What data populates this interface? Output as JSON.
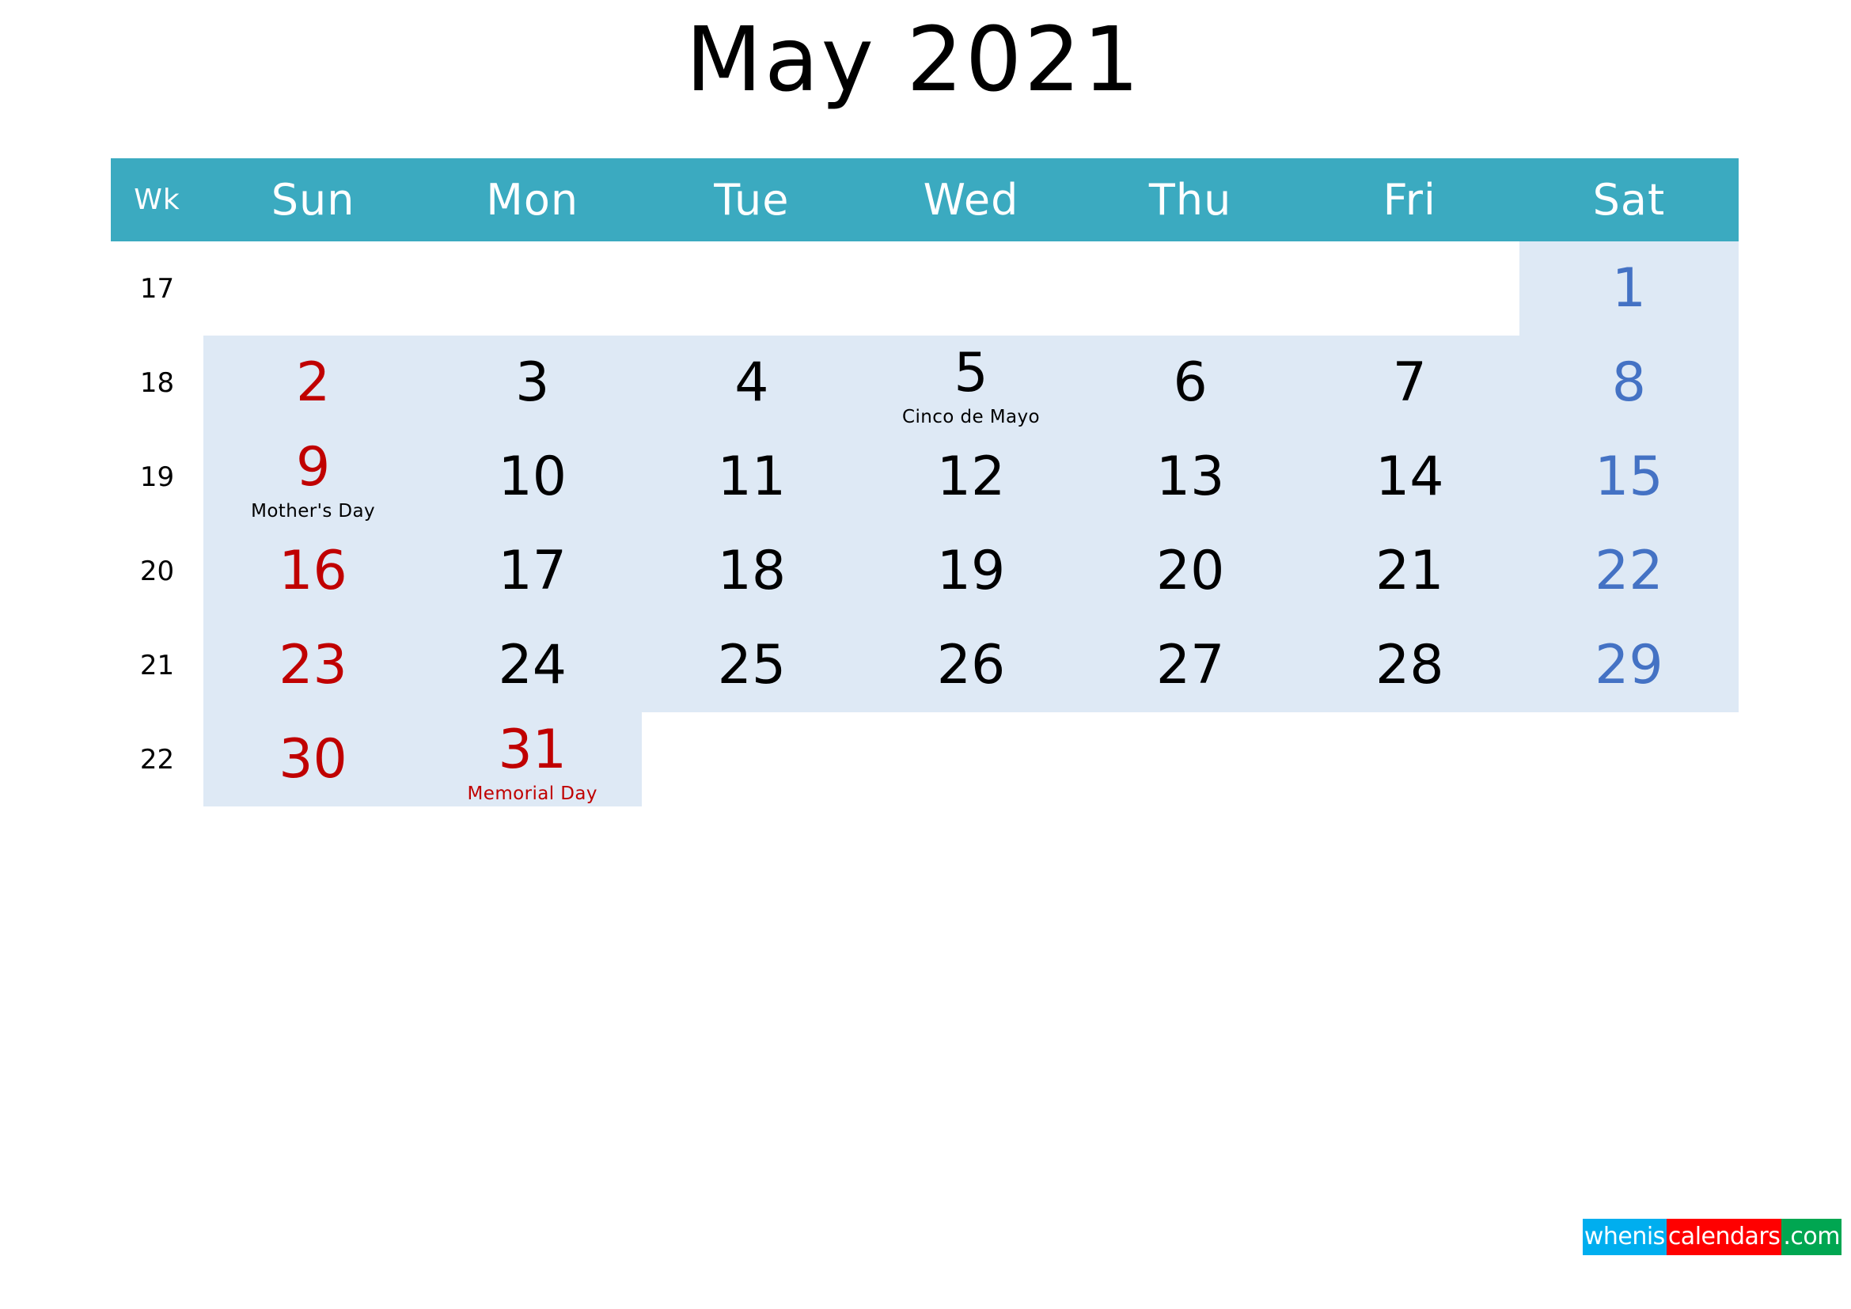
{
  "title": "May 2021",
  "header": {
    "wk_label": "Wk",
    "days": [
      "Sun",
      "Mon",
      "Tue",
      "Wed",
      "Thu",
      "Fri",
      "Sat"
    ]
  },
  "colors": {
    "header_bar": "#3BAAC0",
    "shading": "#DEE9F5",
    "sunday": "#C00000",
    "saturday": "#4472C4",
    "weekday": "#000000",
    "holiday": "#C00000"
  },
  "weeks": [
    {
      "wk": "17",
      "days": [
        {
          "num": "",
          "kind": "empty",
          "event": "",
          "event_color": ""
        },
        {
          "num": "",
          "kind": "empty",
          "event": "",
          "event_color": ""
        },
        {
          "num": "",
          "kind": "empty",
          "event": "",
          "event_color": ""
        },
        {
          "num": "",
          "kind": "empty",
          "event": "",
          "event_color": ""
        },
        {
          "num": "",
          "kind": "empty",
          "event": "",
          "event_color": ""
        },
        {
          "num": "",
          "kind": "empty",
          "event": "",
          "event_color": ""
        },
        {
          "num": "1",
          "kind": "saturday",
          "event": "",
          "event_color": ""
        }
      ]
    },
    {
      "wk": "18",
      "days": [
        {
          "num": "2",
          "kind": "sunday",
          "event": "",
          "event_color": ""
        },
        {
          "num": "3",
          "kind": "weekday",
          "event": "",
          "event_color": ""
        },
        {
          "num": "4",
          "kind": "weekday",
          "event": "",
          "event_color": ""
        },
        {
          "num": "5",
          "kind": "weekday",
          "event": "Cinco de Mayo",
          "event_color": "ev-black"
        },
        {
          "num": "6",
          "kind": "weekday",
          "event": "",
          "event_color": ""
        },
        {
          "num": "7",
          "kind": "weekday",
          "event": "",
          "event_color": ""
        },
        {
          "num": "8",
          "kind": "saturday",
          "event": "",
          "event_color": ""
        }
      ]
    },
    {
      "wk": "19",
      "days": [
        {
          "num": "9",
          "kind": "sunday",
          "event": "Mother's Day",
          "event_color": "ev-black"
        },
        {
          "num": "10",
          "kind": "weekday",
          "event": "",
          "event_color": ""
        },
        {
          "num": "11",
          "kind": "weekday",
          "event": "",
          "event_color": ""
        },
        {
          "num": "12",
          "kind": "weekday",
          "event": "",
          "event_color": ""
        },
        {
          "num": "13",
          "kind": "weekday",
          "event": "",
          "event_color": ""
        },
        {
          "num": "14",
          "kind": "weekday",
          "event": "",
          "event_color": ""
        },
        {
          "num": "15",
          "kind": "saturday",
          "event": "",
          "event_color": ""
        }
      ]
    },
    {
      "wk": "20",
      "days": [
        {
          "num": "16",
          "kind": "sunday",
          "event": "",
          "event_color": ""
        },
        {
          "num": "17",
          "kind": "weekday",
          "event": "",
          "event_color": ""
        },
        {
          "num": "18",
          "kind": "weekday",
          "event": "",
          "event_color": ""
        },
        {
          "num": "19",
          "kind": "weekday",
          "event": "",
          "event_color": ""
        },
        {
          "num": "20",
          "kind": "weekday",
          "event": "",
          "event_color": ""
        },
        {
          "num": "21",
          "kind": "weekday",
          "event": "",
          "event_color": ""
        },
        {
          "num": "22",
          "kind": "saturday",
          "event": "",
          "event_color": ""
        }
      ]
    },
    {
      "wk": "21",
      "days": [
        {
          "num": "23",
          "kind": "sunday",
          "event": "",
          "event_color": ""
        },
        {
          "num": "24",
          "kind": "weekday",
          "event": "",
          "event_color": ""
        },
        {
          "num": "25",
          "kind": "weekday",
          "event": "",
          "event_color": ""
        },
        {
          "num": "26",
          "kind": "weekday",
          "event": "",
          "event_color": ""
        },
        {
          "num": "27",
          "kind": "weekday",
          "event": "",
          "event_color": ""
        },
        {
          "num": "28",
          "kind": "weekday",
          "event": "",
          "event_color": ""
        },
        {
          "num": "29",
          "kind": "saturday",
          "event": "",
          "event_color": ""
        }
      ]
    },
    {
      "wk": "22",
      "days": [
        {
          "num": "30",
          "kind": "sunday",
          "event": "",
          "event_color": ""
        },
        {
          "num": "31",
          "kind": "holiday",
          "event": "Memorial Day",
          "event_color": "ev-red"
        },
        {
          "num": "",
          "kind": "empty",
          "event": "",
          "event_color": ""
        },
        {
          "num": "",
          "kind": "empty",
          "event": "",
          "event_color": ""
        },
        {
          "num": "",
          "kind": "empty",
          "event": "",
          "event_color": ""
        },
        {
          "num": "",
          "kind": "empty",
          "event": "",
          "event_color": ""
        },
        {
          "num": "",
          "kind": "empty",
          "event": "",
          "event_color": ""
        }
      ]
    }
  ],
  "logo": {
    "part1": "whenis",
    "part2": "calendars",
    "part3": ".com"
  }
}
